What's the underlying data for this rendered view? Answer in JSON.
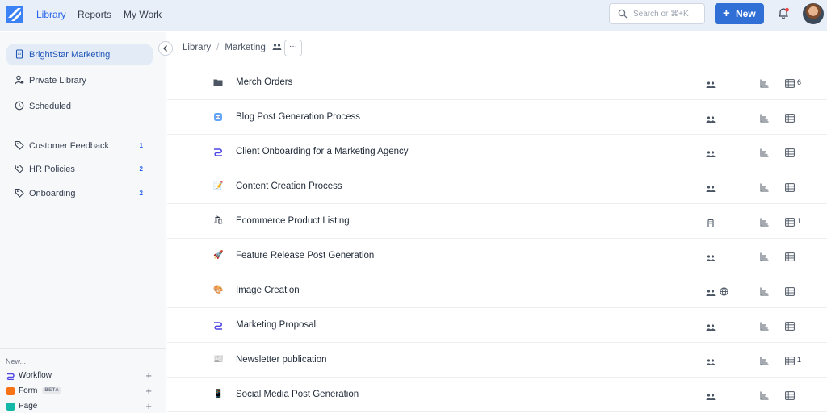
{
  "colors": {
    "accent": "#2563eb",
    "primary_button": "#2f6fd6",
    "topbar_bg": "#e9eff8",
    "sidebar_active_bg": "#e3ebf6",
    "notification_dot": "#ef4444"
  },
  "topbar": {
    "logo_icon": "diagonal-stripe-logo",
    "nav": [
      "Library",
      "Reports",
      "My Work"
    ],
    "active_nav": "Library",
    "search": {
      "placeholder": "Search or ⌘+K",
      "icon": "search-icon"
    },
    "new_button": {
      "label": "New",
      "icon": "plus-icon"
    },
    "notifications_icon": "bell-icon",
    "avatar_icon": "user-avatar"
  },
  "sidebar": {
    "workspaces": [
      {
        "label": "BrightStar Marketing",
        "icon": "building-icon",
        "active": true
      },
      {
        "label": "Private Library",
        "icon": "private-user-icon"
      },
      {
        "label": "Scheduled",
        "icon": "clock-icon"
      }
    ],
    "tags": [
      {
        "label": "Customer Feedback",
        "count": "1",
        "icon": "tag-icon"
      },
      {
        "label": "HR Policies",
        "count": "2",
        "icon": "tag-icon"
      },
      {
        "label": "Onboarding",
        "count": "2",
        "icon": "tag-icon"
      }
    ],
    "new_section": {
      "title": "New...",
      "items": [
        {
          "label": "Workflow",
          "icon": "workflow-icon",
          "color": "#4f46e5"
        },
        {
          "label": "Form",
          "badge": "BETA",
          "icon": "form-icon",
          "color": "#f97316"
        },
        {
          "label": "Page",
          "icon": "page-icon",
          "color": "#14b8a6"
        }
      ]
    }
  },
  "breadcrumb": {
    "root": "Library",
    "current": "Marketing",
    "more_label": "···"
  },
  "rows": [
    {
      "name": "Merch Orders",
      "icon": "folder-icon",
      "glyph": "",
      "share": "team-icon",
      "globe": false,
      "table_count": "6"
    },
    {
      "name": "Blog Post Generation Process",
      "icon": "blog-robot-icon",
      "glyph": "",
      "share": "team-icon",
      "globe": false,
      "table_count": ""
    },
    {
      "name": "Client Onboarding for a Marketing Agency",
      "icon": "workflow-icon",
      "glyph": "",
      "share": "team-icon",
      "globe": false,
      "table_count": ""
    },
    {
      "name": "Content Creation Process",
      "icon": "memo-icon",
      "glyph": "📝",
      "share": "team-icon",
      "globe": false,
      "table_count": ""
    },
    {
      "name": "Ecommerce Product Listing",
      "icon": "shopping-bags-icon",
      "glyph": "🛍",
      "share": "building-icon",
      "globe": false,
      "table_count": "1"
    },
    {
      "name": "Feature Release Post Generation",
      "icon": "rocket-icon",
      "glyph": "🚀",
      "share": "team-icon",
      "globe": false,
      "table_count": ""
    },
    {
      "name": "Image Creation",
      "icon": "palette-icon",
      "glyph": "🎨",
      "share": "team-icon",
      "globe": true,
      "table_count": ""
    },
    {
      "name": "Marketing Proposal",
      "icon": "workflow-icon",
      "glyph": "",
      "share": "team-icon",
      "globe": false,
      "table_count": ""
    },
    {
      "name": "Newsletter publication",
      "icon": "newspaper-icon",
      "glyph": "📰",
      "share": "team-icon",
      "globe": false,
      "table_count": "1"
    },
    {
      "name": "Social Media Post Generation",
      "icon": "mobile-phone-icon",
      "glyph": "📱",
      "share": "team-icon",
      "globe": false,
      "table_count": ""
    }
  ]
}
